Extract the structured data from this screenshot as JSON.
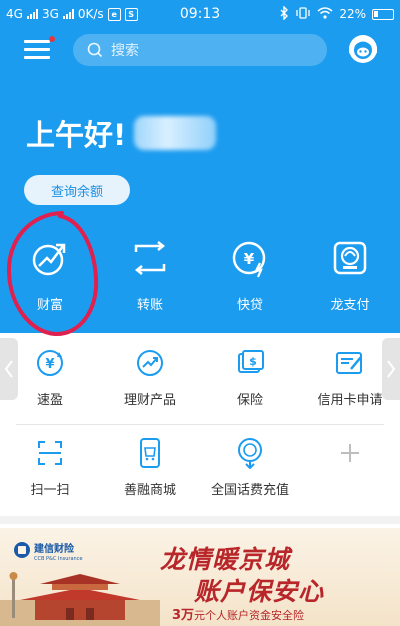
{
  "status_bar": {
    "net1": "4G",
    "net2": "3G",
    "speed": "0K/s",
    "time": "09:13",
    "battery": "22%"
  },
  "search": {
    "placeholder": "搜索"
  },
  "greeting": {
    "text": "上午好!"
  },
  "balance_button": "查询余额",
  "main_actions": [
    {
      "label": "财富",
      "icon": "wealth-icon"
    },
    {
      "label": "转账",
      "icon": "transfer-icon"
    },
    {
      "label": "快贷",
      "icon": "quick-loan-icon"
    },
    {
      "label": "龙支付",
      "icon": "long-pay-icon"
    }
  ],
  "grid_row1": [
    {
      "label": "速盈",
      "icon": "yen-cycle-icon"
    },
    {
      "label": "理财产品",
      "icon": "chart-trend-icon"
    },
    {
      "label": "保险",
      "icon": "insurance-doc-icon"
    },
    {
      "label": "信用卡申请",
      "icon": "credit-card-form-icon"
    }
  ],
  "grid_row2": [
    {
      "label": "扫一扫",
      "icon": "scan-icon"
    },
    {
      "label": "善融商城",
      "icon": "mall-phone-icon"
    },
    {
      "label": "全国话费充值",
      "icon": "phone-recharge-icon"
    }
  ],
  "banner": {
    "logo_cn": "建信财险",
    "logo_en": "CCB P&C Insurance",
    "title1": "龙情暖京城",
    "title2": "账户保安心",
    "sub_amount": "3万",
    "sub_text": "元个人账户资金安全险"
  },
  "colors": {
    "primary_blue": "#1c9cef",
    "accent_red": "#e0204f",
    "banner_red": "#b8262a"
  }
}
